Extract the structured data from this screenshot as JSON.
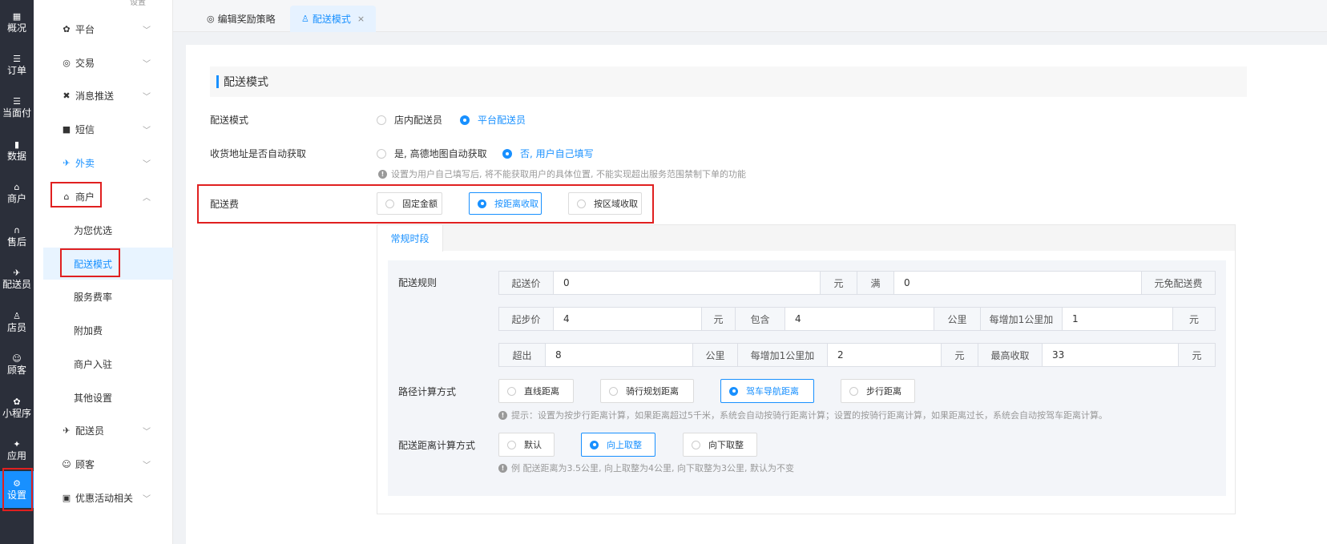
{
  "rail": [
    {
      "key": "overview",
      "icon": "▦",
      "label": "概况"
    },
    {
      "key": "orders",
      "icon": "☰",
      "label": "订单"
    },
    {
      "key": "facepay",
      "icon": "☰",
      "label": "当面付"
    },
    {
      "key": "data",
      "icon": "▮",
      "label": "数据"
    },
    {
      "key": "merchant",
      "icon": "⌂",
      "label": "商户"
    },
    {
      "key": "aftersale",
      "icon": "∩",
      "label": "售后"
    },
    {
      "key": "rider",
      "icon": "✈",
      "label": "配送员"
    },
    {
      "key": "staff",
      "icon": "♙",
      "label": "店员"
    },
    {
      "key": "customer",
      "icon": "☺",
      "label": "顾客"
    },
    {
      "key": "miniapp",
      "icon": "✿",
      "label": "小程序"
    },
    {
      "key": "apps",
      "icon": "✦",
      "label": "应用"
    },
    {
      "key": "settings",
      "icon": "⚙",
      "label": "设置"
    }
  ],
  "menu": {
    "top_cut": "设置",
    "items": [
      {
        "icon": "✿",
        "label": "平台",
        "chev": "﹀"
      },
      {
        "icon": "◎",
        "label": "交易",
        "chev": "﹀"
      },
      {
        "icon": "✖",
        "label": "消息推送",
        "chev": "﹀"
      },
      {
        "icon": "■",
        "label": "短信",
        "chev": "﹀"
      },
      {
        "icon": "✈",
        "label": "外卖",
        "chev": "﹀"
      },
      {
        "icon": "⌂",
        "label": "商户",
        "chev": "︿"
      },
      {
        "icon": "",
        "label": "为您优选",
        "chev": ""
      },
      {
        "icon": "",
        "label": "配送模式",
        "chev": ""
      },
      {
        "icon": "",
        "label": "服务费率",
        "chev": ""
      },
      {
        "icon": "",
        "label": "附加费",
        "chev": ""
      },
      {
        "icon": "",
        "label": "商户入驻",
        "chev": ""
      },
      {
        "icon": "",
        "label": "其他设置",
        "chev": ""
      },
      {
        "icon": "✈",
        "label": "配送员",
        "chev": "﹀"
      },
      {
        "icon": "☺",
        "label": "顾客",
        "chev": "﹀"
      },
      {
        "icon": "▣",
        "label": "优惠活动相关",
        "chev": "﹀"
      }
    ]
  },
  "tabs": [
    {
      "icon": "◎",
      "label": "编辑奖励策略"
    },
    {
      "icon": "♙",
      "label": "配送模式",
      "close": "×"
    }
  ],
  "section_title": "配送模式",
  "form": {
    "delivery_mode": {
      "label": "配送模式",
      "options": [
        "店内配送员",
        "平台配送员"
      ]
    },
    "address_fetch": {
      "label": "收货地址是否自动获取",
      "options": [
        "是, 高德地图自动获取",
        "否, 用户自己填写"
      ],
      "hint": "设置为用户自己填写后, 将不能获取用户的具体位置, 不能实现超出服务范围禁制下单的功能"
    },
    "delivery_fee": {
      "label": "配送费",
      "options": [
        "固定金额",
        "按距离收取",
        "按区域收取"
      ]
    }
  },
  "subtab": "常规时段",
  "rules": {
    "label": "配送规则",
    "row1": {
      "a": "起送价",
      "v1": "0",
      "u1": "元",
      "b": "满",
      "v2": "0",
      "u2": "元免配送费"
    },
    "row2": {
      "a": "起步价",
      "v1": "4",
      "u1": "元",
      "b": "包含",
      "v2": "4",
      "u2": "公里",
      "c": "每增加1公里加",
      "v3": "1",
      "u3": "元"
    },
    "row3": {
      "a": "超出",
      "v1": "8",
      "u1": "公里",
      "b": "每增加1公里加",
      "v2": "2",
      "u2": "元",
      "c": "最高收取",
      "v3": "33",
      "u3": "元"
    }
  },
  "route": {
    "label": "路径计算方式",
    "options": [
      "直线距离",
      "骑行规划距离",
      "驾车导航距离",
      "步行距离"
    ],
    "hint": "提示：设置为按步行距离计算，如果距离超过5千米，系统会自动按骑行距离计算；设置的按骑行距离计算，如果距离过长，系统会自动按驾车距离计算。"
  },
  "rounding": {
    "label": "配送距离计算方式",
    "options": [
      "默认",
      "向上取整",
      "向下取整"
    ],
    "hint": "例 配送距离为3.5公里, 向上取整为4公里, 向下取整为3公里, 默认为不变"
  },
  "hint_icon": "!",
  "colors": {
    "accent": "#1890ff",
    "rail_bg": "#2b2f3a",
    "highlight": "#e02020"
  }
}
